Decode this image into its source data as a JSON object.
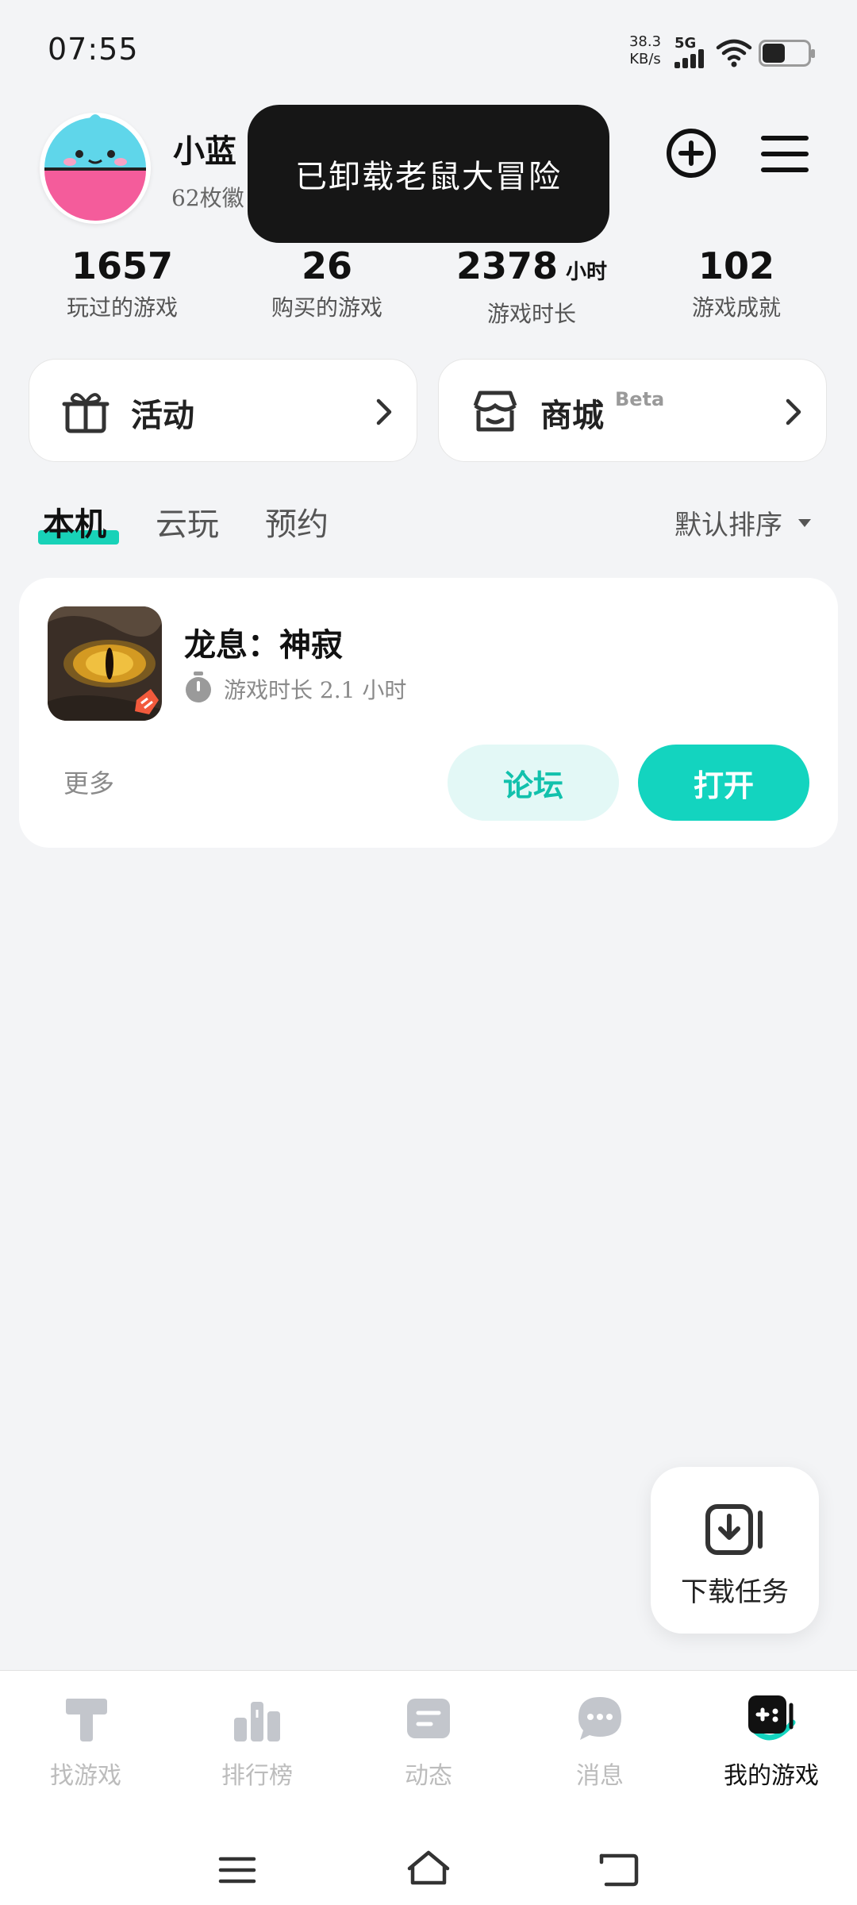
{
  "status_bar": {
    "time": "07:55",
    "net_speed_value": "38.3",
    "net_speed_unit": "KB/s",
    "network": "5G",
    "icons": [
      "signal-icon",
      "wifi-icon",
      "battery-icon"
    ]
  },
  "profile": {
    "username": "小蓝",
    "badges_text": "62枚徽"
  },
  "toast": {
    "message": "已卸载老鼠大冒险"
  },
  "header_icons": [
    "add-circle-icon",
    "menu-icon"
  ],
  "stats": [
    {
      "value": "1657",
      "unit": "",
      "label": "玩过的游戏"
    },
    {
      "value": "26",
      "unit": "",
      "label": "购买的游戏"
    },
    {
      "value": "2378",
      "unit": "小时",
      "label": "游戏时长"
    },
    {
      "value": "102",
      "unit": "",
      "label": "游戏成就"
    }
  ],
  "cards": {
    "activity": {
      "label": "活动",
      "icon": "gift-icon"
    },
    "store": {
      "label": "商城",
      "badge": "Beta",
      "icon": "store-icon"
    }
  },
  "tabs": [
    {
      "label": "本机",
      "active": true
    },
    {
      "label": "云玩",
      "active": false
    },
    {
      "label": "预约",
      "active": false
    }
  ],
  "sort": {
    "label": "默认排序"
  },
  "game": {
    "title": "龙息：神寂",
    "playtime": "游戏时长 2.1 小时",
    "more_label": "更多",
    "forum_label": "论坛",
    "open_label": "打开"
  },
  "download_fab": {
    "label": "下载任务"
  },
  "bottom_nav": [
    {
      "label": "找游戏",
      "icon": "find-games-icon",
      "active": false
    },
    {
      "label": "排行榜",
      "icon": "ranking-icon",
      "active": false
    },
    {
      "label": "动态",
      "icon": "feed-icon",
      "active": false
    },
    {
      "label": "消息",
      "icon": "message-icon",
      "active": false
    },
    {
      "label": "我的游戏",
      "icon": "my-games-icon",
      "active": true
    }
  ],
  "colors": {
    "accent": "#13d4bf",
    "accent_light": "#e3f8f6",
    "background": "#f3f4f6"
  }
}
